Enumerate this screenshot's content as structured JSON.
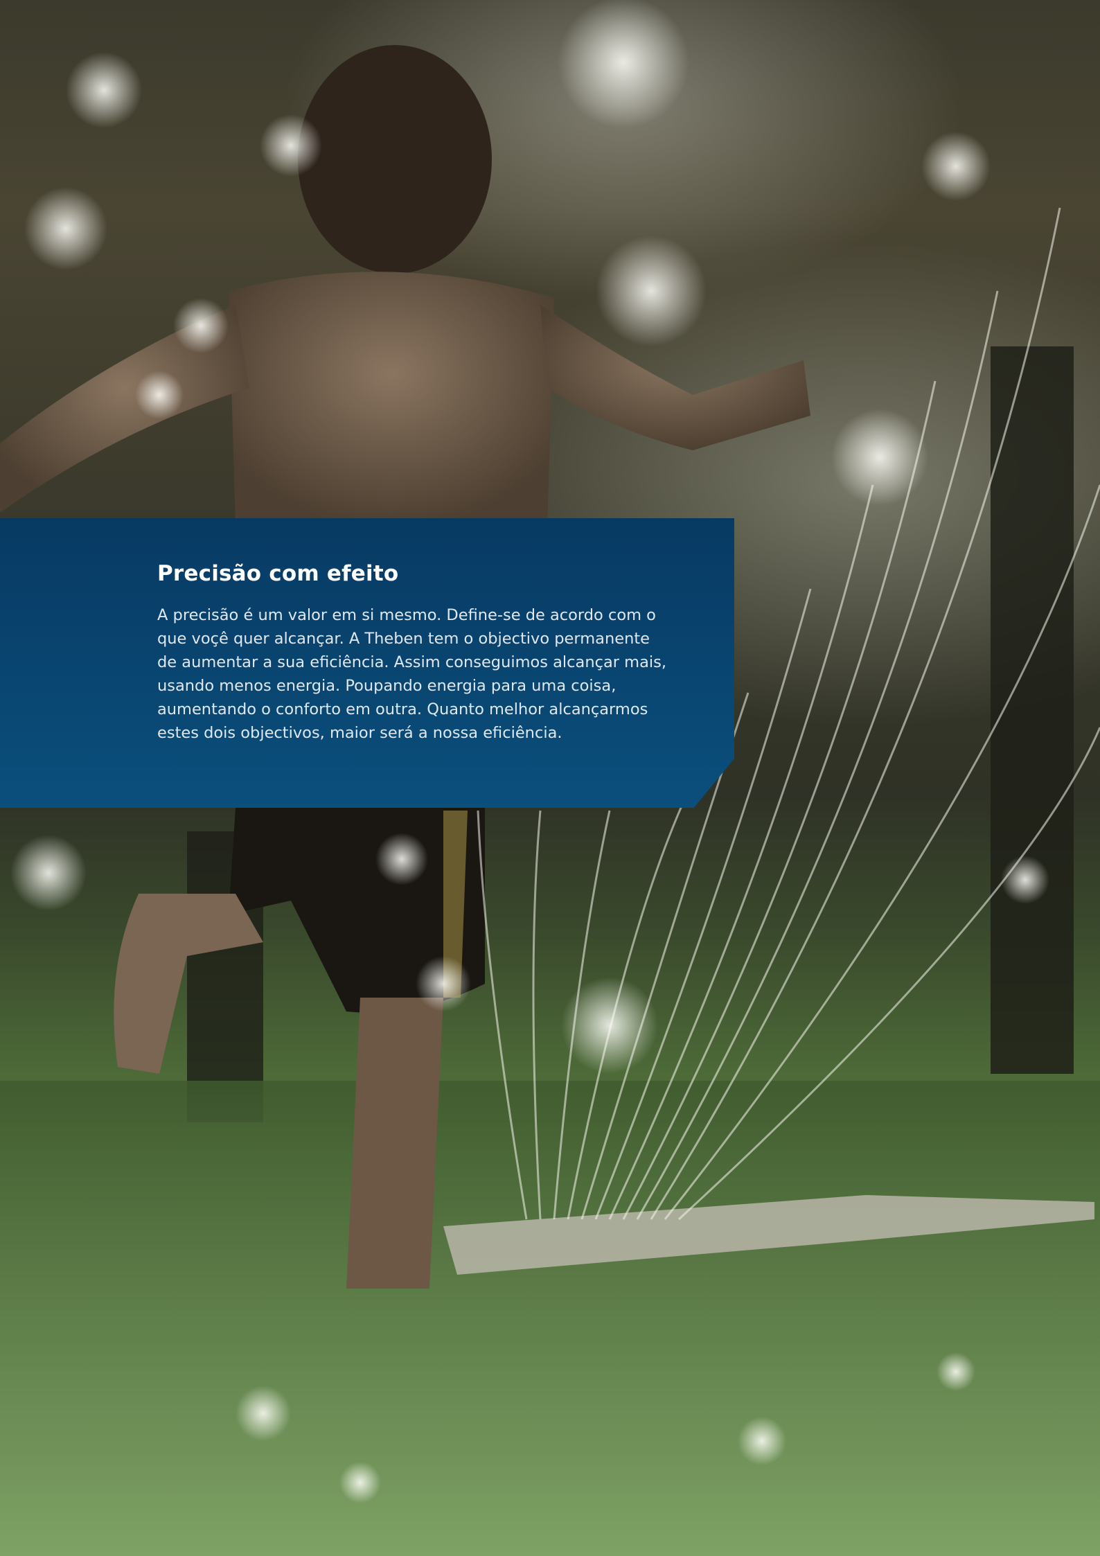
{
  "article": {
    "title": "Precisão com efeito",
    "body_lines": [
      "A precisão é um valor em si mesmo. Define-se de acordo com o",
      "que voçê quer alcançar. A Theben tem o objectivo permanente",
      "de aumentar a sua eficiência. Assim conseguimos alcançar mais,",
      "usando menos energia. Poupando energia para uma coisa,",
      "aumentando o conforto em outra. Quanto melhor alcançarmos",
      "estes dois objectivos, maior será a nossa eficiência."
    ]
  },
  "colors": {
    "panel_blue": "#0b4f7d",
    "panel_blue_dark": "#073a63",
    "title_text": "#ffffff",
    "body_text": "#dfe8f0"
  }
}
